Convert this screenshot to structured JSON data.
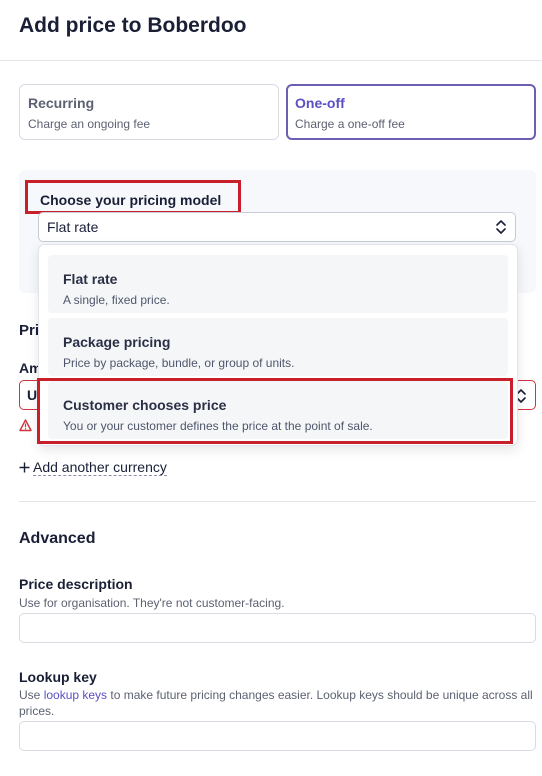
{
  "page": {
    "title": "Add price to Boberdoo"
  },
  "price_type": {
    "recurring": {
      "label": "Recurring",
      "description": "Charge an ongoing fee"
    },
    "one_off": {
      "label": "One-off",
      "description": "Charge a one-off fee",
      "selected": true
    }
  },
  "pricing_model": {
    "label": "Choose your pricing model",
    "selected": "Flat rate",
    "options": [
      {
        "label": "Flat rate",
        "description": "A single, fixed price."
      },
      {
        "label": "Package pricing",
        "description": "Price by package, bundle, or group of units."
      },
      {
        "label": "Customer chooses price",
        "description": "You or your customer defines the price at the point of sale."
      }
    ]
  },
  "price_section": {
    "heading_partial": "Pri",
    "amount_label_partial": "Am",
    "amount_value_partial": "U"
  },
  "add_currency": {
    "label": "Add another currency"
  },
  "advanced": {
    "heading": "Advanced",
    "price_description": {
      "label": "Price description",
      "help": "Use for organisation. They're not customer-facing.",
      "value": ""
    },
    "lookup_key": {
      "label": "Lookup key",
      "help_prefix": "Use ",
      "help_link": "lookup keys",
      "help_suffix": " to make future pricing changes easier. Lookup keys should be unique across all prices.",
      "value": ""
    }
  },
  "colors": {
    "accent": "#5b4fc4",
    "highlight": "#c8202b",
    "error": "#d1343c"
  }
}
